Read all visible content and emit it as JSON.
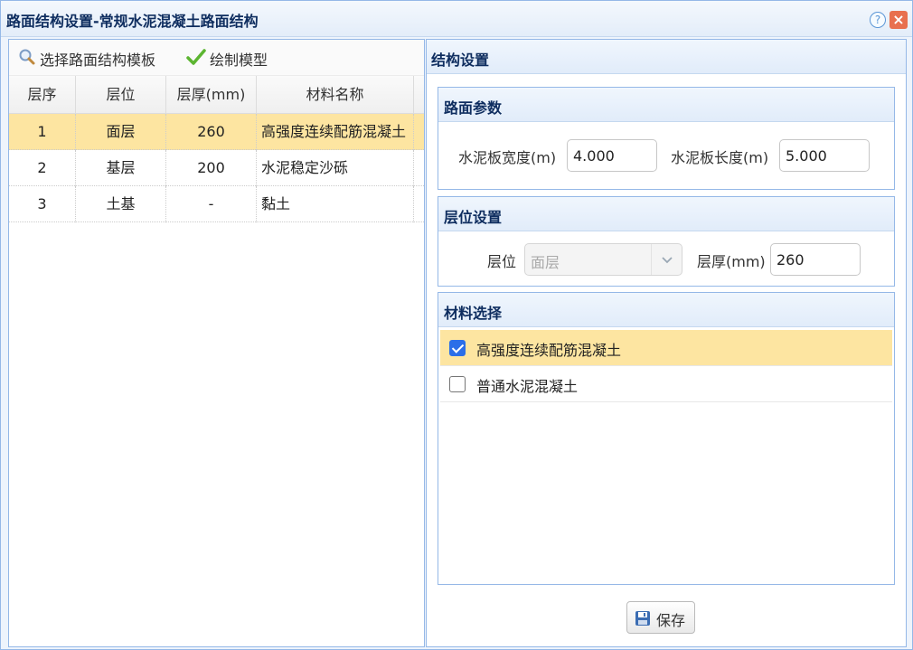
{
  "window": {
    "title": "路面结构设置-常规水泥混凝土路面结构",
    "help_symbol": "?",
    "close_symbol": "×"
  },
  "toolbar": {
    "select_template_label": "选择路面结构模板",
    "draw_model_label": "绘制模型"
  },
  "grid": {
    "columns": [
      "层序",
      "层位",
      "层厚(mm)",
      "材料名称"
    ],
    "rows": [
      {
        "seq": "1",
        "position": "面层",
        "thickness": "260",
        "material": "高强度连续配筋混凝土"
      },
      {
        "seq": "2",
        "position": "基层",
        "thickness": "200",
        "material": "水泥稳定沙砾"
      },
      {
        "seq": "3",
        "position": "土基",
        "thickness": "-",
        "material": "黏土"
      }
    ]
  },
  "structure": {
    "title": "结构设置",
    "road_params": {
      "title": "路面参数",
      "slab_width_label": "水泥板宽度(m)",
      "slab_width_value": "4.000",
      "slab_length_label": "水泥板长度(m)",
      "slab_length_value": "5.000"
    },
    "layer_settings": {
      "title": "层位设置",
      "position_label": "层位",
      "position_value": "面层",
      "thickness_label": "层厚(mm)",
      "thickness_value": "260"
    },
    "material_select": {
      "title": "材料选择",
      "options": [
        {
          "label": "高强度连续配筋混凝土",
          "checked": true
        },
        {
          "label": "普通水泥混凝土",
          "checked": false
        }
      ]
    },
    "save_label": "保存"
  },
  "colors": {
    "selected_row": "#fde5a1",
    "header_text": "#0e2d5f",
    "border": "#95b8e7",
    "checkbox_accent": "#2b6ee8"
  }
}
